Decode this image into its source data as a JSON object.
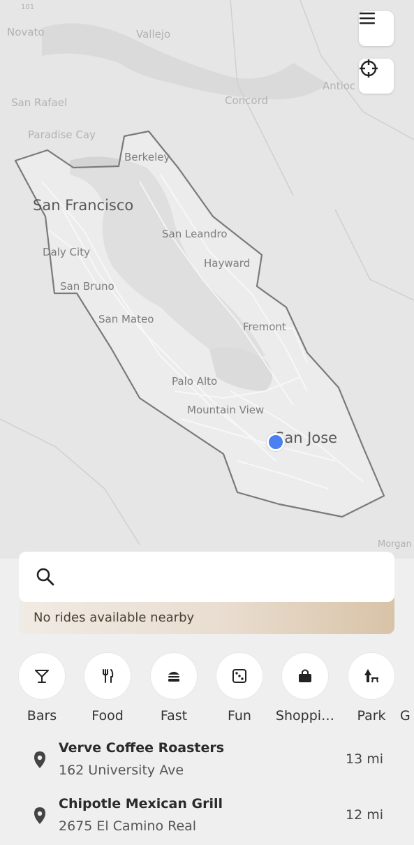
{
  "map": {
    "labels": {
      "novato": "Novato",
      "vallejo": "Vallejo",
      "antioch": "Antioc",
      "san_rafael": "San Rafael",
      "concord": "Concord",
      "paradise_cay": "Paradise Cay",
      "berkeley": "Berkeley",
      "san_francisco": "San Francisco",
      "san_leandro": "San Leandro",
      "daly_city": "Daly City",
      "hayward": "Hayward",
      "san_bruno": "San Bruno",
      "san_mateo": "San Mateo",
      "fremont": "Fremont",
      "palo_alto": "Palo Alto",
      "mountain_view": "Mountain View",
      "san_jose": "San Jose",
      "morgan": "Morgan"
    },
    "buttons": {
      "menu_icon": "menu-icon",
      "locate_icon": "crosshair-icon"
    },
    "location_color": "#4a80f0"
  },
  "search": {
    "placeholder": "",
    "value": "",
    "notice": "No rides available nearby"
  },
  "categories": [
    {
      "label": "Bars",
      "icon": "cocktail-icon"
    },
    {
      "label": "Food",
      "icon": "fork-knife-icon"
    },
    {
      "label": "Fast",
      "icon": "burger-icon"
    },
    {
      "label": "Fun",
      "icon": "dice-icon"
    },
    {
      "label": "Shoppi…",
      "icon": "shopping-bag-icon"
    },
    {
      "label": "Park",
      "icon": "park-icon"
    },
    {
      "label": "G",
      "icon": ""
    }
  ],
  "places": [
    {
      "name": "Verve Coffee Roasters",
      "address": "162 University Ave",
      "distance": "13 mi"
    },
    {
      "name": "Chipotle Mexican Grill",
      "address": "2675 El Camino Real",
      "distance": "12 mi"
    }
  ]
}
